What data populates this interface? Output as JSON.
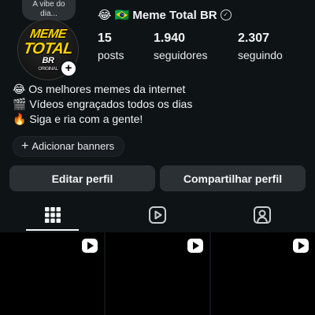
{
  "note": {
    "line1": "A vibe do",
    "line2": "dia..."
  },
  "profile": {
    "name_emoji": "😂 🇧🇷",
    "name": "Meme Total BR",
    "avatar_logo": {
      "line1": "MEME",
      "line2": "TOTAL",
      "line3": "BR",
      "line4": "ORIGINAL"
    }
  },
  "stats": [
    {
      "value": "15",
      "label": "posts"
    },
    {
      "value": "1.940",
      "label": "seguidores"
    },
    {
      "value": "2.307",
      "label": "seguindo"
    }
  ],
  "bio": [
    "😂 Os melhores memes da internet",
    "🎬 Vídeos engraçados todos os dias",
    "🔥 Siga e ria com a gente!"
  ],
  "banner_chip": {
    "label": "Adicionar banners"
  },
  "buttons": {
    "edit": "Editar perfil",
    "share": "Compartilhar perfil"
  },
  "tabs": [
    {
      "icon": "grid-icon",
      "selected": true
    },
    {
      "icon": "reels-icon",
      "selected": false
    },
    {
      "icon": "tagged-icon",
      "selected": false
    }
  ],
  "grid_items": [
    {
      "type": "reel",
      "icon": "play-icon"
    },
    {
      "type": "reel",
      "icon": "play-icon"
    },
    {
      "type": "reel",
      "icon": "play-icon"
    }
  ]
}
